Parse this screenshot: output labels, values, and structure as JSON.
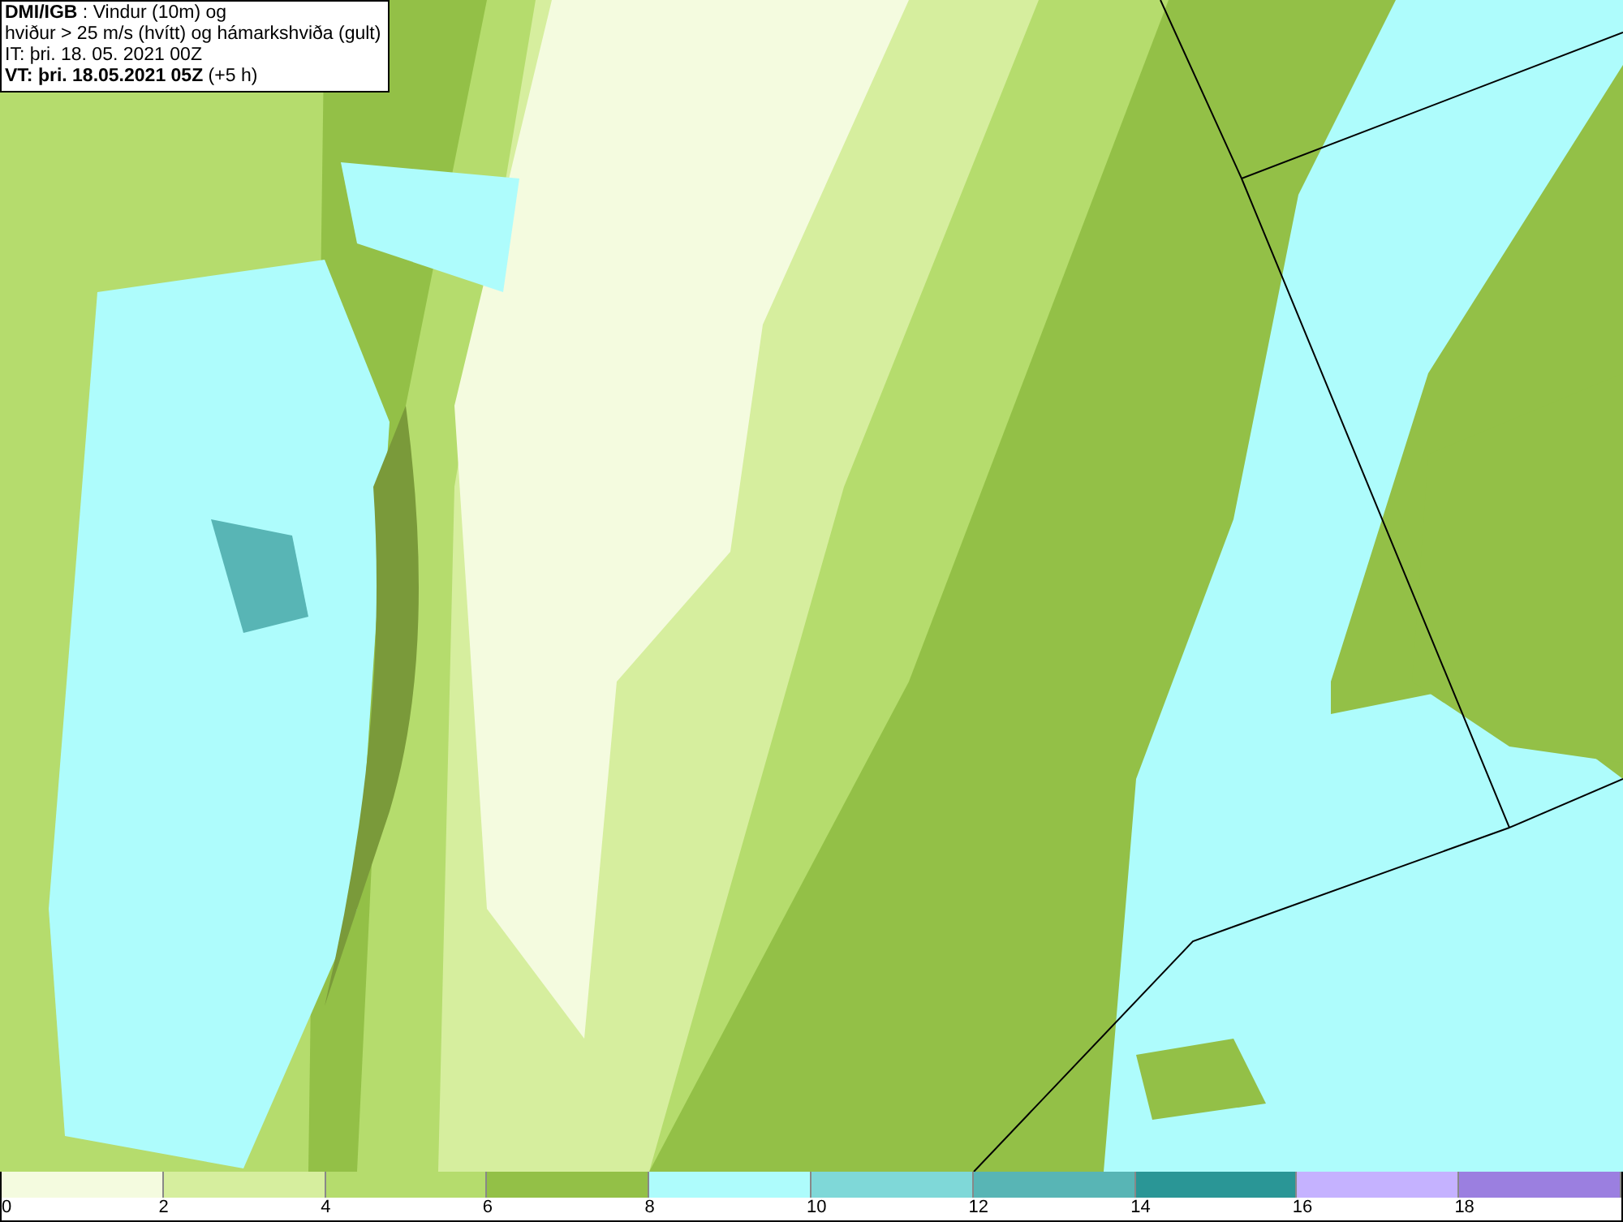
{
  "info_box": {
    "lines": [
      "**DMI/IGB** : Vindur (10m) og",
      "hviður > 25 m/s (hvítt) og hámarkshviða (gult)",
      "IT: þri. 18. 05. 2021 00Z",
      "**VT: þri. 18.05.2021 05Z** (+5 h)"
    ]
  },
  "legend": {
    "bins": [
      {
        "color": "#f4fbdf"
      },
      {
        "color": "#d6ee9e"
      },
      {
        "color": "#b5dc6d"
      },
      {
        "color": "#93c047"
      },
      {
        "color": "#aefcfc"
      },
      {
        "color": "#7fd8d8"
      },
      {
        "color": "#58b5b5"
      },
      {
        "color": "#2a9696"
      },
      {
        "color": "#c5b2ff"
      },
      {
        "color": "#9b7fe0"
      }
    ],
    "labels": [
      "0",
      "2",
      "4",
      "6",
      "8",
      "10",
      "12",
      "14",
      "16",
      "18"
    ]
  }
}
